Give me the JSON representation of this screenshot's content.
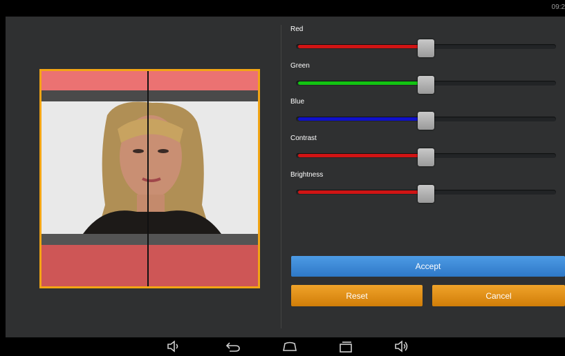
{
  "status_bar": {
    "time": "09:2"
  },
  "sliders": [
    {
      "label": "Red",
      "value": 0.5,
      "color": "#d01414"
    },
    {
      "label": "Green",
      "value": 0.5,
      "color": "#12c412"
    },
    {
      "label": "Blue",
      "value": 0.5,
      "color": "#1010c8"
    },
    {
      "label": "Contrast",
      "value": 0.5,
      "color": "#d01414"
    },
    {
      "label": "Brightness",
      "value": 0.5,
      "color": "#d01414"
    }
  ],
  "buttons": {
    "accept": "Accept",
    "reset": "Reset",
    "cancel": "Cancel"
  },
  "colors": {
    "accept": "#3a88d6",
    "orange": "#e8920f",
    "frame": "#f2a515"
  },
  "nav_icons": [
    "volume-down-icon",
    "back-icon",
    "home-icon",
    "recent-apps-icon",
    "volume-up-icon"
  ]
}
